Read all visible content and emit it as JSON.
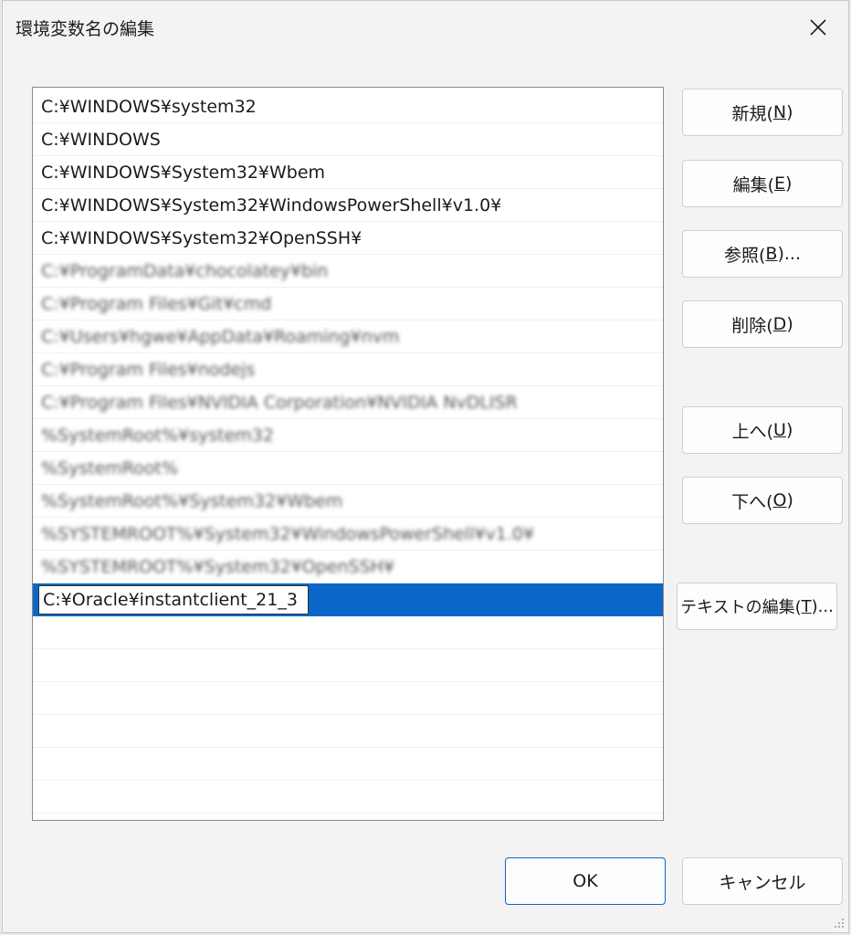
{
  "window": {
    "title": "環境変数名の編集"
  },
  "list": {
    "items": [
      {
        "text": "C:¥WINDOWS¥system32",
        "blurred": false
      },
      {
        "text": "C:¥WINDOWS",
        "blurred": false
      },
      {
        "text": "C:¥WINDOWS¥System32¥Wbem",
        "blurred": false
      },
      {
        "text": "C:¥WINDOWS¥System32¥WindowsPowerShell¥v1.0¥",
        "blurred": false
      },
      {
        "text": "C:¥WINDOWS¥System32¥OpenSSH¥",
        "blurred": false
      },
      {
        "text": "C:¥ProgramData¥chocolatey¥bin",
        "blurred": true
      },
      {
        "text": "C:¥Program Files¥Git¥cmd",
        "blurred": true
      },
      {
        "text": "C:¥Users¥hgwe¥AppData¥Roaming¥nvm",
        "blurred": true
      },
      {
        "text": "C:¥Program Files¥nodejs",
        "blurred": true
      },
      {
        "text": "C:¥Program Files¥NVIDIA Corporation¥NVIDIA NvDLISR",
        "blurred": true
      },
      {
        "text": "%SystemRoot%¥system32",
        "blurred": true
      },
      {
        "text": "%SystemRoot%",
        "blurred": true
      },
      {
        "text": "%SystemRoot%¥System32¥Wbem",
        "blurred": true
      },
      {
        "text": "%SYSTEMROOT%¥System32¥WindowsPowerShell¥v1.0¥",
        "blurred": true
      },
      {
        "text": "%SYSTEMROOT%¥System32¥OpenSSH¥",
        "blurred": true
      }
    ],
    "editing_value": "C:¥Oracle¥instantclient_21_3"
  },
  "buttons": {
    "new": {
      "label": "新規(",
      "mnemonic": "N",
      "suffix": ")"
    },
    "edit": {
      "label": "編集(",
      "mnemonic": "E",
      "suffix": ")"
    },
    "browse": {
      "label": "参照(",
      "mnemonic": "B",
      "suffix": ")..."
    },
    "delete": {
      "label": "削除(",
      "mnemonic": "D",
      "suffix": ")"
    },
    "up": {
      "label": "上へ(",
      "mnemonic": "U",
      "suffix": ")"
    },
    "down": {
      "label": "下へ(",
      "mnemonic": "O",
      "suffix": ")"
    },
    "edit_text": {
      "label": "テキストの編集(",
      "mnemonic": "T",
      "suffix": ")..."
    },
    "ok": "OK",
    "cancel": "キャンセル"
  },
  "colors": {
    "selection": "#0a67c7",
    "dialog_bg": "#f3f3f3"
  }
}
